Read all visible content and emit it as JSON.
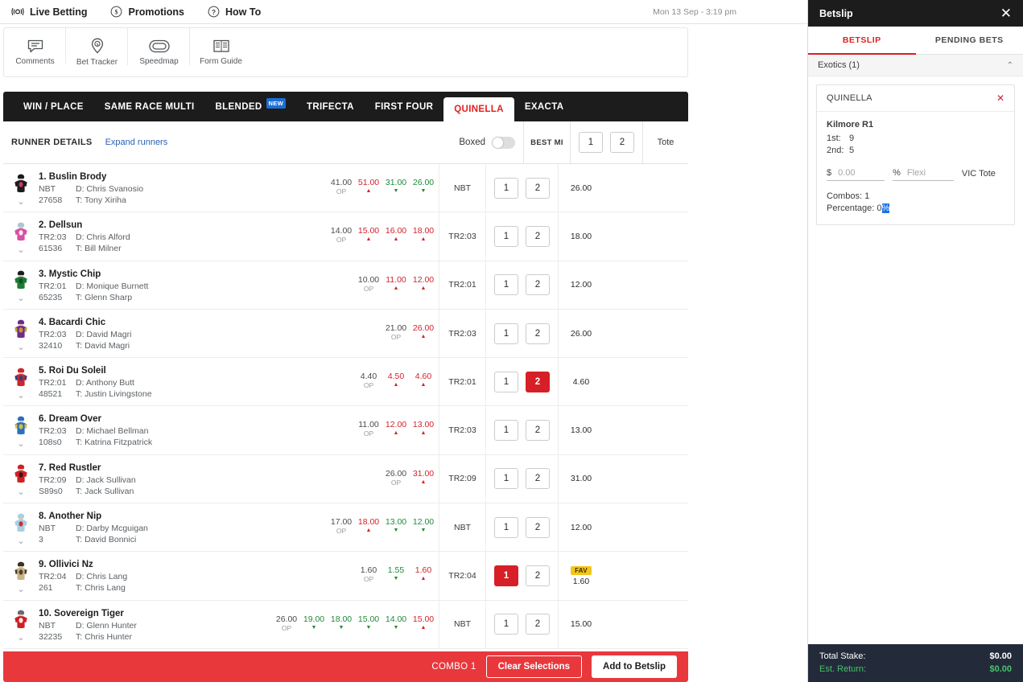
{
  "topnav": {
    "items": [
      {
        "label": "Live Betting",
        "icon": "live-betting-icon"
      },
      {
        "label": "Promotions",
        "icon": "dollar-circle-icon"
      },
      {
        "label": "How To",
        "icon": "question-circle-icon"
      }
    ],
    "clock": "Mon 13 Sep - 3:19 pm"
  },
  "tools": [
    {
      "label": "Comments",
      "icon": "comment-icon"
    },
    {
      "label": "Bet Tracker",
      "icon": "bet-tracker-pin-icon"
    },
    {
      "label": "Speedmap",
      "icon": "speedmap-icon"
    },
    {
      "label": "Form Guide",
      "icon": "form-guide-book-icon"
    }
  ],
  "tabs": [
    {
      "label": "WIN / PLACE",
      "active": false,
      "badge": null
    },
    {
      "label": "SAME RACE MULTI",
      "active": false,
      "badge": null
    },
    {
      "label": "BLENDED",
      "active": false,
      "badge": "NEW"
    },
    {
      "label": "TRIFECTA",
      "active": false,
      "badge": null
    },
    {
      "label": "FIRST FOUR",
      "active": false,
      "badge": null
    },
    {
      "label": "QUINELLA",
      "active": true,
      "badge": null
    },
    {
      "label": "EXACTA",
      "active": false,
      "badge": null
    }
  ],
  "colheader": {
    "runner_details": "RUNNER DETAILS",
    "expand_runners": "Expand runners",
    "boxed": "Boxed",
    "boxed_on": false,
    "best_mi": "BEST MI",
    "sel1": "1",
    "sel2": "2",
    "tote": "Tote"
  },
  "runners": [
    {
      "number": "1",
      "name": "1. Buslin Brody",
      "best_mi_left": "NBT",
      "form": "27658",
      "driver": "D: Chris Svanosio",
      "trainer": "T: Tony Xiriha",
      "silk": {
        "body": "#1b1b1b",
        "sleeve": "#1b1b1b",
        "cap": "#1b1b1b",
        "accent": "#e8317e"
      },
      "odds": [
        {
          "value": "41.00",
          "sub": "OP",
          "dir": "op"
        },
        {
          "value": "51.00",
          "sub": "",
          "dir": "up"
        },
        {
          "value": "31.00",
          "sub": "",
          "dir": "down"
        },
        {
          "value": "26.00",
          "sub": "",
          "dir": "down"
        }
      ],
      "best_mi": "NBT",
      "sel1": "1",
      "sel2": "2",
      "sel1_on": false,
      "sel2_on": false,
      "tote": "26.00",
      "fav": false
    },
    {
      "number": "2",
      "name": "2. Dellsun",
      "best_mi_left": "TR2:03",
      "form": "61536",
      "driver": "D: Chris Alford",
      "trainer": "T: Bill Milner",
      "silk": {
        "body": "#d94fa3",
        "sleeve": "#d94fa3",
        "cap": "#a9c7dd",
        "accent": "#ffffff"
      },
      "odds": [
        {
          "value": "14.00",
          "sub": "OP",
          "dir": "op"
        },
        {
          "value": "15.00",
          "sub": "",
          "dir": "up"
        },
        {
          "value": "16.00",
          "sub": "",
          "dir": "up"
        },
        {
          "value": "18.00",
          "sub": "",
          "dir": "up"
        }
      ],
      "best_mi": "TR2:03",
      "sel1": "1",
      "sel2": "2",
      "sel1_on": false,
      "sel2_on": false,
      "tote": "18.00",
      "fav": false
    },
    {
      "number": "3",
      "name": "3. Mystic Chip",
      "best_mi_left": "TR2:01",
      "form": "65235",
      "driver": "D: Monique Burnett",
      "trainer": "T: Glenn Sharp",
      "silk": {
        "body": "#1f7a34",
        "sleeve": "#1f7a34",
        "cap": "#1b1b1b",
        "accent": "#0d4a1d"
      },
      "odds": [
        {
          "value": "10.00",
          "sub": "OP",
          "dir": "op"
        },
        {
          "value": "11.00",
          "sub": "",
          "dir": "up"
        },
        {
          "value": "12.00",
          "sub": "",
          "dir": "up"
        }
      ],
      "best_mi": "TR2:01",
      "sel1": "1",
      "sel2": "2",
      "sel1_on": false,
      "sel2_on": false,
      "tote": "12.00",
      "fav": false
    },
    {
      "number": "4",
      "name": "4. Bacardi Chic",
      "best_mi_left": "TR2:03",
      "form": "32410",
      "driver": "D: David Magri",
      "trainer": "T: David Magri",
      "silk": {
        "body": "#6f2b8f",
        "sleeve": "#c9a227",
        "cap": "#6f2b8f",
        "accent": "#c9a227"
      },
      "odds": [
        {
          "value": "21.00",
          "sub": "OP",
          "dir": "op"
        },
        {
          "value": "26.00",
          "sub": "",
          "dir": "up"
        }
      ],
      "best_mi": "TR2:03",
      "sel1": "1",
      "sel2": "2",
      "sel1_on": false,
      "sel2_on": false,
      "tote": "26.00",
      "fav": false
    },
    {
      "number": "5",
      "name": "5. Roi Du Soleil",
      "best_mi_left": "TR2:01",
      "form": "48521",
      "driver": "D: Anthony Butt",
      "trainer": "T: Justin Livingstone",
      "silk": {
        "body": "#d0242c",
        "sleeve": "#2a3f87",
        "cap": "#d0242c",
        "accent": "#2a3f87"
      },
      "odds": [
        {
          "value": "4.40",
          "sub": "OP",
          "dir": "op"
        },
        {
          "value": "4.50",
          "sub": "",
          "dir": "up"
        },
        {
          "value": "4.60",
          "sub": "",
          "dir": "up"
        }
      ],
      "best_mi": "TR2:01",
      "sel1": "1",
      "sel2": "2",
      "sel1_on": false,
      "sel2_on": true,
      "tote": "4.60",
      "fav": false
    },
    {
      "number": "6",
      "name": "6. Dream Over",
      "best_mi_left": "TR2:03",
      "form": "108s0",
      "driver": "D: Michael Bellman",
      "trainer": "T: Katrina Fitzpatrick",
      "silk": {
        "body": "#2a6fc4",
        "sleeve": "#e3c531",
        "cap": "#2a6fc4",
        "accent": "#e3c531"
      },
      "odds": [
        {
          "value": "11.00",
          "sub": "OP",
          "dir": "op"
        },
        {
          "value": "12.00",
          "sub": "",
          "dir": "up"
        },
        {
          "value": "13.00",
          "sub": "",
          "dir": "up"
        }
      ],
      "best_mi": "TR2:03",
      "sel1": "1",
      "sel2": "2",
      "sel1_on": false,
      "sel2_on": false,
      "tote": "13.00",
      "fav": false
    },
    {
      "number": "7",
      "name": "7. Red Rustler",
      "best_mi_left": "TR2:09",
      "form": "S89s0",
      "driver": "D: Jack Sullivan",
      "trainer": "T: Jack Sullivan",
      "silk": {
        "body": "#cf2026",
        "sleeve": "#cf2026",
        "cap": "#cf2026",
        "accent": "#1b1b1b"
      },
      "odds": [
        {
          "value": "26.00",
          "sub": "OP",
          "dir": "op"
        },
        {
          "value": "31.00",
          "sub": "",
          "dir": "up"
        }
      ],
      "best_mi": "TR2:09",
      "sel1": "1",
      "sel2": "2",
      "sel1_on": false,
      "sel2_on": false,
      "tote": "31.00",
      "fav": false
    },
    {
      "number": "8",
      "name": "8. Another Nip",
      "best_mi_left": "NBT",
      "form": "3",
      "driver": "D: Darby Mcguigan",
      "trainer": "T: David Bonnici",
      "silk": {
        "body": "#a8cfe3",
        "sleeve": "#a8cfe3",
        "cap": "#a8cfe3",
        "accent": "#cf2026"
      },
      "odds": [
        {
          "value": "17.00",
          "sub": "OP",
          "dir": "op"
        },
        {
          "value": "18.00",
          "sub": "",
          "dir": "up"
        },
        {
          "value": "13.00",
          "sub": "",
          "dir": "down"
        },
        {
          "value": "12.00",
          "sub": "",
          "dir": "down"
        }
      ],
      "best_mi": "NBT",
      "sel1": "1",
      "sel2": "2",
      "sel1_on": false,
      "sel2_on": false,
      "tote": "12.00",
      "fav": false
    },
    {
      "number": "9",
      "name": "9. Ollivici Nz",
      "best_mi_left": "TR2:04",
      "form": "261",
      "driver": "D: Chris Lang",
      "trainer": "T: Chris Lang",
      "silk": {
        "body": "#c8b48a",
        "sleeve": "#4a3a24",
        "cap": "#3a3024",
        "accent": "#4a3a24"
      },
      "odds": [
        {
          "value": "1.60",
          "sub": "OP",
          "dir": "op"
        },
        {
          "value": "1.55",
          "sub": "",
          "dir": "down"
        },
        {
          "value": "1.60",
          "sub": "",
          "dir": "up"
        }
      ],
      "best_mi": "TR2:04",
      "sel1": "1",
      "sel2": "2",
      "sel1_on": true,
      "sel2_on": false,
      "tote": "1.60",
      "fav": true,
      "fav_label": "FAV"
    },
    {
      "number": "10",
      "name": "10. Sovereign Tiger",
      "best_mi_left": "NBT",
      "form": "32235",
      "driver": "D: Glenn Hunter",
      "trainer": "T: Chris Hunter",
      "silk": {
        "body": "#cf2026",
        "sleeve": "#cf2026",
        "cap": "#6b6b6b",
        "accent": "#ffffff"
      },
      "odds": [
        {
          "value": "26.00",
          "sub": "OP",
          "dir": "op"
        },
        {
          "value": "19.00",
          "sub": "",
          "dir": "down"
        },
        {
          "value": "18.00",
          "sub": "",
          "dir": "down"
        },
        {
          "value": "15.00",
          "sub": "",
          "dir": "down"
        },
        {
          "value": "14.00",
          "sub": "",
          "dir": "down"
        },
        {
          "value": "15.00",
          "sub": "",
          "dir": "up"
        }
      ],
      "best_mi": "NBT",
      "sel1": "1",
      "sel2": "2",
      "sel1_on": false,
      "sel2_on": false,
      "tote": "15.00",
      "fav": false
    }
  ],
  "actionbar": {
    "combo": "COMBO 1",
    "clear": "Clear Selections",
    "add": "Add to Betslip"
  },
  "betslip": {
    "title": "Betslip",
    "close": "✕",
    "tabs": [
      {
        "label": "BETSLIP",
        "active": true
      },
      {
        "label": "PENDING BETS",
        "active": false
      }
    ],
    "group_label": "Exotics (1)",
    "group_chevron": "⌃",
    "card": {
      "type": "QUINELLA",
      "remove": "✕",
      "race": "Kilmore R1",
      "leg1_label": "1st:",
      "leg1_value": "9",
      "leg2_label": "2nd:",
      "leg2_value": "5",
      "dollar_prefix": "$",
      "stake_value": "",
      "stake_placeholder": "0.00",
      "percent_prefix": "%",
      "flexi_value": "",
      "flexi_placeholder": "Flexi",
      "tote": "VIC Tote",
      "combos_label": "Combos:",
      "combos_value": "1",
      "percentage_label": "Percentage:",
      "percentage_value": "0",
      "percentage_symbol": "%"
    },
    "footer": {
      "total_stake_label": "Total Stake:",
      "total_stake_value": "$0.00",
      "est_return_label": "Est. Return:",
      "est_return_value": "$0.00"
    }
  },
  "colors": {
    "accent_red": "#d61f26",
    "action_red": "#e8383c",
    "dark": "#1c1c1c",
    "footer_dark": "#232b3a",
    "up": "#d0242c",
    "down": "#1d8b3a",
    "fav_gold": "#f5c518"
  }
}
